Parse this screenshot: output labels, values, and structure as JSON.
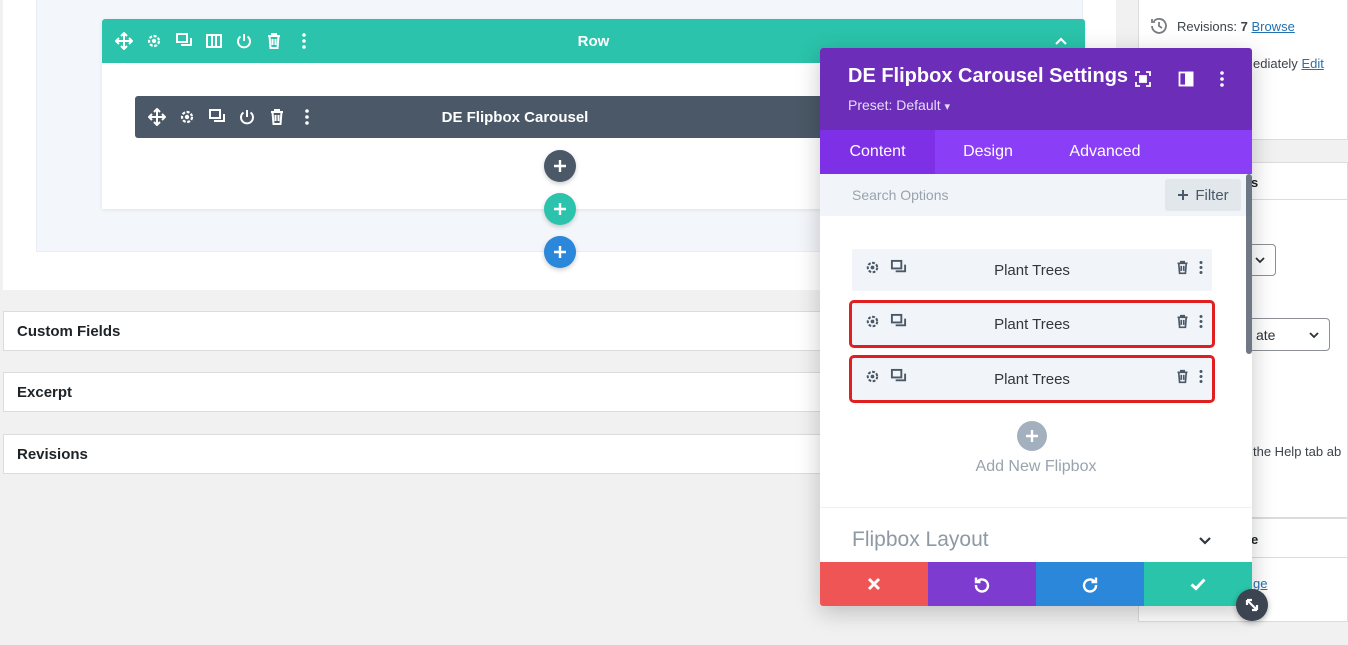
{
  "builder": {
    "row_label": "Row",
    "module_label": "DE Flipbox Carousel"
  },
  "metaboxes": {
    "custom_fields": "Custom Fields",
    "excerpt": "Excerpt",
    "revisions": "Revisions"
  },
  "sidebar": {
    "revisions_label": "Revisions:",
    "revisions_count": "7",
    "browse_link": "Browse",
    "immediately_text": "ediately",
    "edit_link": "Edit",
    "box2_fragment": "s",
    "select_value": "ate",
    "help_text": "the Help tab ab",
    "box3_fragment": "e",
    "link_fragment": "ge"
  },
  "modal": {
    "title": "DE Flipbox Carousel Settings",
    "preset": "Preset: Default",
    "preset_caret": "▾",
    "tabs": [
      "Content",
      "Design",
      "Advanced"
    ],
    "search_placeholder": "Search Options",
    "filter_label": "Filter",
    "items": [
      {
        "label": "Plant Trees"
      },
      {
        "label": "Plant Trees"
      },
      {
        "label": "Plant Trees"
      }
    ],
    "add_new_label": "Add New Flipbox",
    "layout_section": "Flipbox Layout"
  },
  "colors": {
    "row_bar": "#2bc3ab",
    "module_bar": "#4a5867",
    "modal_header": "#6c2eb9",
    "modal_tabs": "#8a3ef5",
    "selection_outline": "#e02020",
    "cancel": "#ef5555",
    "undo": "#7e3bd0",
    "redo": "#2b87da",
    "save": "#29c4a9"
  }
}
